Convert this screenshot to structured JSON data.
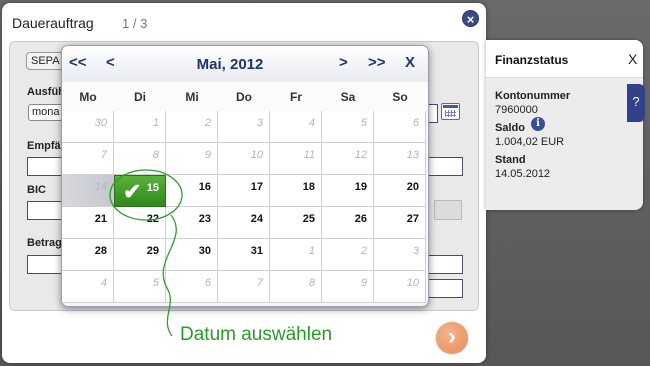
{
  "dialog": {
    "title": "Dauerauftrag",
    "step": "1 / 3",
    "close_icon": "close-icon",
    "tab_label": "SEPA",
    "labels": {
      "ausfuehrung": "Ausfüh",
      "empfaenger": "Empfän",
      "bic": "BIC",
      "betrag": "Betrag"
    },
    "select_value": "mona",
    "next_icon": "chevron-right-icon",
    "next_glyph": "›"
  },
  "finanzstatus": {
    "title": "Finanzstatus",
    "close": "X",
    "kontonummer_label": "Kontonummer",
    "kontonummer": "7960000",
    "saldo_label": "Saldo",
    "saldo": "1.004,02 EUR",
    "stand_label": "Stand",
    "stand": "14.05.2012",
    "info_glyph": "i",
    "help_glyph": "?"
  },
  "calendar": {
    "month": "Mai, 2012",
    "nav": {
      "prev_year": "<<",
      "prev": "<",
      "next": ">",
      "next_year": ">>",
      "close": "X"
    },
    "weekdays": [
      "Mo",
      "Di",
      "Mi",
      "Do",
      "Fr",
      "Sa",
      "So"
    ],
    "weeks": [
      [
        {
          "d": "30",
          "s": "other"
        },
        {
          "d": "1",
          "s": "past"
        },
        {
          "d": "2",
          "s": "past"
        },
        {
          "d": "3",
          "s": "past"
        },
        {
          "d": "4",
          "s": "past"
        },
        {
          "d": "5",
          "s": "past"
        },
        {
          "d": "6",
          "s": "past"
        }
      ],
      [
        {
          "d": "7",
          "s": "past"
        },
        {
          "d": "8",
          "s": "past"
        },
        {
          "d": "9",
          "s": "past"
        },
        {
          "d": "10",
          "s": "past"
        },
        {
          "d": "11",
          "s": "past"
        },
        {
          "d": "12",
          "s": "past"
        },
        {
          "d": "13",
          "s": "past"
        }
      ],
      [
        {
          "d": "14",
          "s": "today"
        },
        {
          "d": "15",
          "s": "selected"
        },
        {
          "d": "16",
          "s": "active"
        },
        {
          "d": "17",
          "s": "active"
        },
        {
          "d": "18",
          "s": "active"
        },
        {
          "d": "19",
          "s": "active"
        },
        {
          "d": "20",
          "s": "active"
        }
      ],
      [
        {
          "d": "21",
          "s": "active"
        },
        {
          "d": "22",
          "s": "active"
        },
        {
          "d": "23",
          "s": "active"
        },
        {
          "d": "24",
          "s": "active"
        },
        {
          "d": "25",
          "s": "active"
        },
        {
          "d": "26",
          "s": "active"
        },
        {
          "d": "27",
          "s": "active"
        }
      ],
      [
        {
          "d": "28",
          "s": "active"
        },
        {
          "d": "29",
          "s": "active"
        },
        {
          "d": "30",
          "s": "active"
        },
        {
          "d": "31",
          "s": "active"
        },
        {
          "d": "1",
          "s": "other"
        },
        {
          "d": "2",
          "s": "other"
        },
        {
          "d": "3",
          "s": "other"
        }
      ],
      [
        {
          "d": "4",
          "s": "other"
        },
        {
          "d": "5",
          "s": "other"
        },
        {
          "d": "6",
          "s": "other"
        },
        {
          "d": "7",
          "s": "other"
        },
        {
          "d": "8",
          "s": "other"
        },
        {
          "d": "9",
          "s": "other"
        },
        {
          "d": "10",
          "s": "other"
        }
      ]
    ],
    "selected_day": "15",
    "check_icon": "checkmark-icon",
    "check_glyph": "✔",
    "selected_color": "#3f9a2a"
  },
  "annotation": {
    "text": "Datum auswählen",
    "color": "#2a9a2a"
  }
}
